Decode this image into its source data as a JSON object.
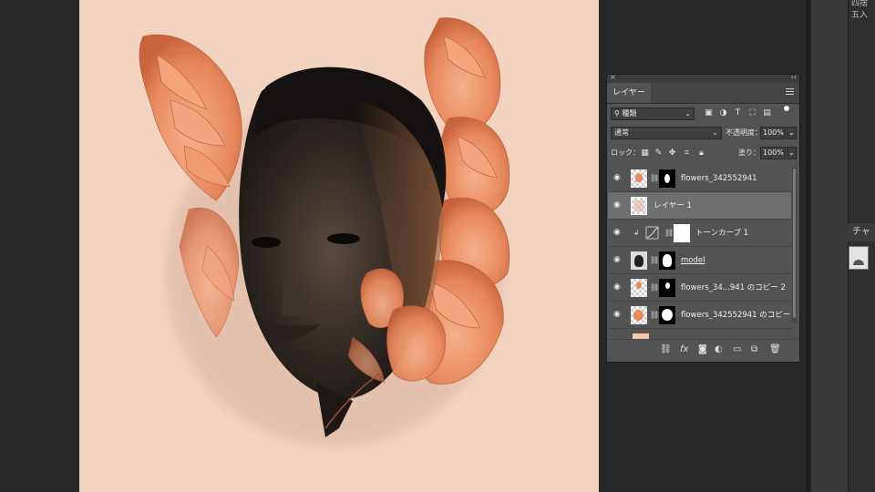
{
  "right_area": {
    "top_label": "四捨五入",
    "channels_tab": "チャ"
  },
  "layers_panel": {
    "close_symbol": "×",
    "collapse_symbol": "‹‹",
    "tab_label": "レイヤー",
    "filter_kind": "種類",
    "blend_mode": "通常",
    "opacity_label": "不透明度：",
    "opacity_value": "100%",
    "lock_label": "ロック：",
    "fill_label": "塗り：",
    "fill_value": "100%",
    "layers": [
      {
        "name": "flowers_342552941",
        "selected": false,
        "visible": true
      },
      {
        "name": "レイヤー 1",
        "selected": true,
        "visible": true
      },
      {
        "name": "トーンカーブ 1",
        "selected": false,
        "visible": true
      },
      {
        "name": "model",
        "selected": false,
        "visible": true
      },
      {
        "name": "flowers_34...941 のコピー 2",
        "selected": false,
        "visible": true
      },
      {
        "name": "flowers_342552941 のコピー",
        "selected": false,
        "visible": true
      }
    ],
    "footer_icons": [
      "link-icon",
      "fx-icon",
      "mask-icon",
      "adjustment-icon",
      "folder-icon",
      "new-layer-icon",
      "trash-icon"
    ]
  },
  "colors": {
    "canvas_bg": "#f2d3bf",
    "workspace_bg": "#282828",
    "panel_bg": "#535353",
    "selected_row": "#6f6f6f",
    "flower": "#e8895e"
  }
}
